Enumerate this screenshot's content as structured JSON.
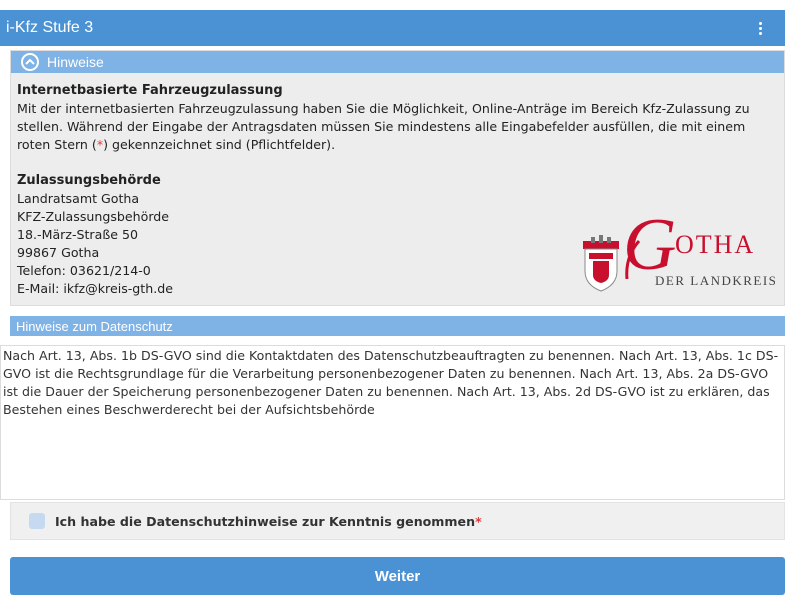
{
  "app": {
    "title": "i-Kfz Stufe 3"
  },
  "colors": {
    "primary": "#4a92d4",
    "section_header": "#7fb2e5",
    "required": "#e23b3b",
    "logo_red": "#c8102e"
  },
  "hinweise": {
    "header": "Hinweise",
    "intro_heading": "Internetbasierte Fahrzeugzulassung",
    "intro_text_1": "Mit der internetbasierten Fahrzeugzulassung haben Sie die Möglichkeit, Online-Anträge im Bereich Kfz-Zulassung zu stellen. Während der Eingabe der Antragsdaten müssen Sie mindestens alle Eingabefelder ausfüllen, die mit einem roten Stern (",
    "star": "*",
    "intro_text_2": ") gekennzeichnet sind (Pflichtfelder).",
    "authority_heading": "Zulassungsbehörde",
    "address": [
      "Landratsamt Gotha",
      "KFZ-Zulassungsbehörde",
      "18.-März-Straße 50",
      "99867 Gotha",
      "Telefon: 03621/214-0",
      "E-Mail: ikfz@kreis-gth.de"
    ],
    "logo": {
      "name_initial": "G",
      "name_rest": "OTHA",
      "subtitle": "DER LANDKREIS",
      "icon": "coat-of-arms-icon"
    }
  },
  "datenschutz": {
    "header": "Hinweise zum Datenschutz",
    "text": "Nach Art. 13, Abs. 1b DS-GVO sind die Kontaktdaten des Datenschutzbeauftragten zu benennen. Nach Art. 13, Abs. 1c DS-GVO ist die Rechtsgrundlage für die Verarbeitung personenbezogener Daten zu benennen. Nach Art. 13, Abs. 2a DS-GVO ist die Dauer der Speicherung personenbezogener Daten zu benennen. Nach Art. 13, Abs. 2d DS-GVO ist zu erklären, das Bestehen eines Beschwerderecht bei der Aufsichtsbehörde",
    "checkbox_label": "Ich habe die Datenschutzhinweise zur Kenntnis genommen",
    "required_star": "*"
  },
  "actions": {
    "next_label": "Weiter"
  }
}
